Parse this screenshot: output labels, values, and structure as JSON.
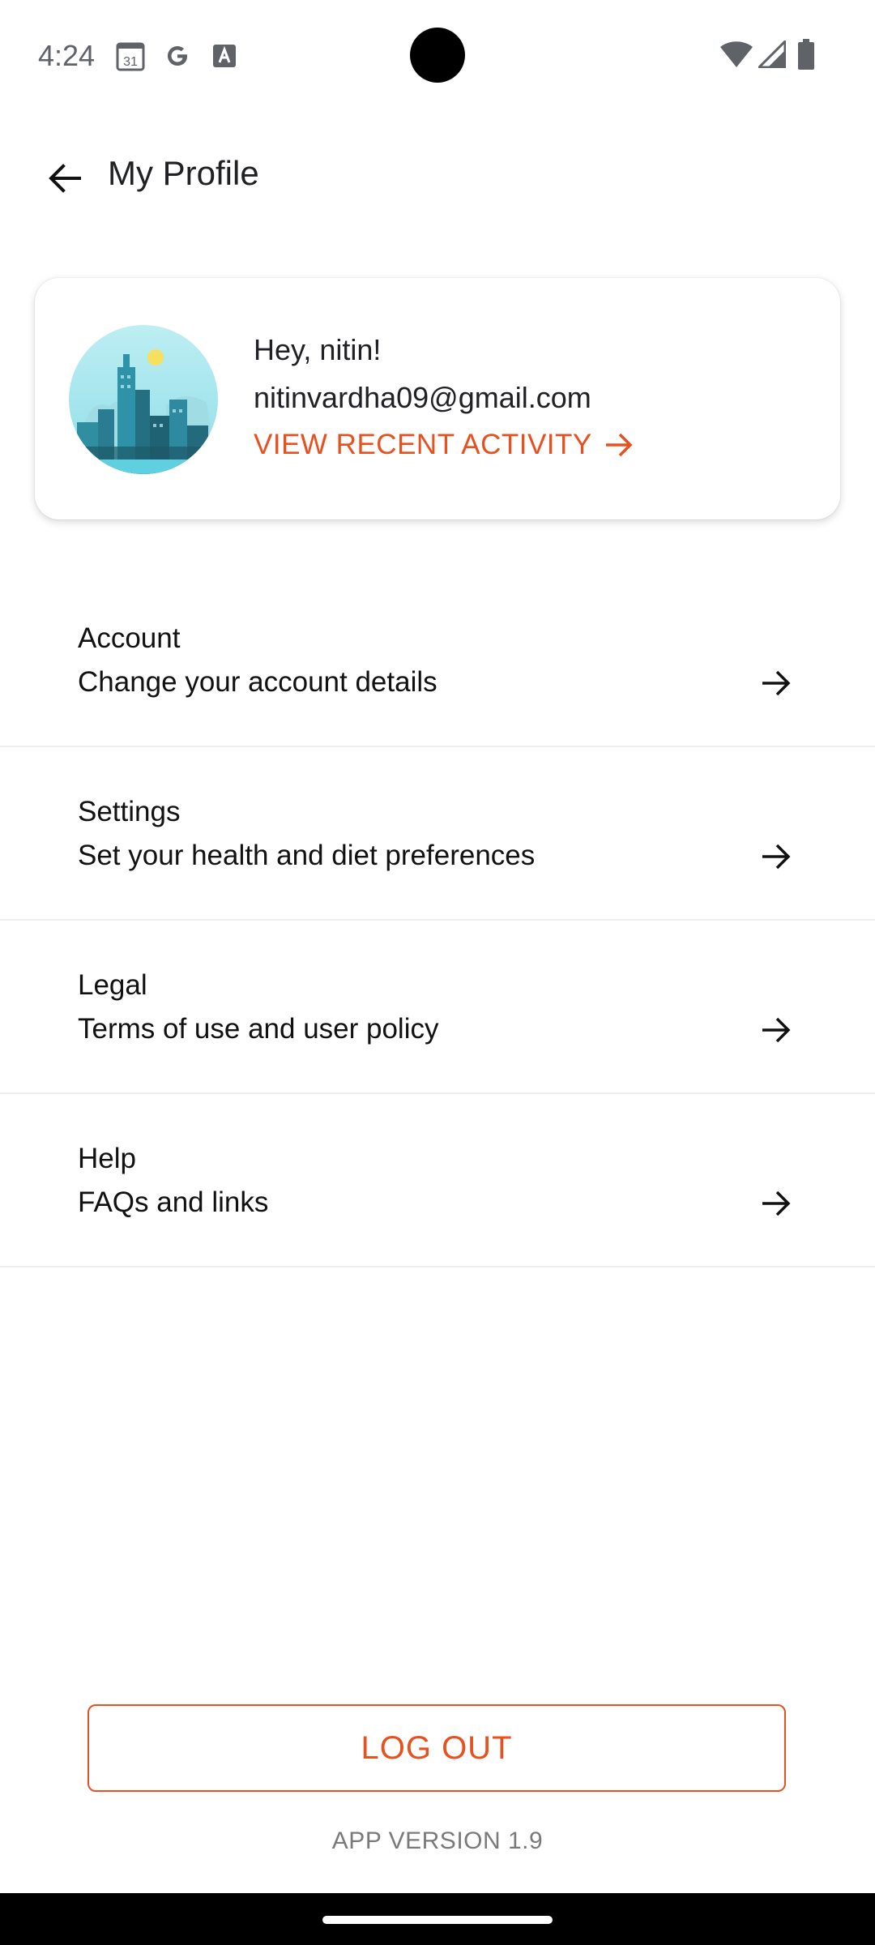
{
  "status_bar": {
    "time": "4:24",
    "calendar_day": "31",
    "icons": [
      "calendar-icon",
      "google-icon",
      "text-a-icon",
      "wifi-icon",
      "signal-icon",
      "battery-icon"
    ]
  },
  "header": {
    "title": "My Profile",
    "back_icon": "arrow-back-icon"
  },
  "profile": {
    "greeting": "Hey, nitin!",
    "email": "nitinvardha09@gmail.com",
    "recent_activity_label": "VIEW RECENT ACTIVITY",
    "avatar_icon": "city-skyline-avatar"
  },
  "menu": {
    "items": [
      {
        "title": "Account",
        "subtitle": "Change your account details"
      },
      {
        "title": "Settings",
        "subtitle": "Set your health and diet preferences"
      },
      {
        "title": "Legal",
        "subtitle": "Terms of use and user policy"
      },
      {
        "title": "Help",
        "subtitle": "FAQs and links"
      }
    ]
  },
  "footer": {
    "logout_label": "LOG OUT",
    "app_version": "APP VERSION 1.9"
  },
  "colors": {
    "accent": "#e8501f",
    "text": "#111111",
    "divider": "#eeeeee"
  }
}
